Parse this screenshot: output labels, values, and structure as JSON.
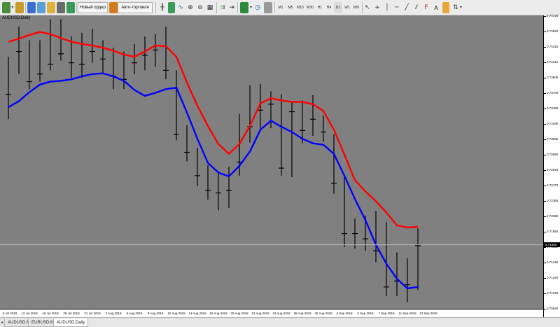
{
  "toolbar": {
    "new_order_label": "Новый ордер",
    "autotrading_label": "Авто-торговля",
    "timeframes": [
      "M1",
      "M5",
      "M15",
      "M30",
      "H1",
      "H4",
      "D1",
      "W1",
      "MN"
    ],
    "text_tool_label": "A",
    "icons": [
      "new-chart-icon",
      "profiles-icon",
      "market-watch-icon",
      "data-window-icon",
      "navigator-icon",
      "terminal-icon",
      "strategy-tester-icon",
      "new-order-icon",
      "autotrading-icon",
      "bar-chart-icon",
      "candlesticks-icon",
      "line-chart-icon",
      "zoom-in-icon",
      "zoom-out-icon",
      "tile-windows-icon",
      "autoscroll-icon",
      "chart-shift-icon",
      "indicators-icon",
      "periods-icon",
      "templates-icon",
      "cursor-icon",
      "crosshair-icon",
      "vertical-line-icon",
      "horizontal-line-icon",
      "trendline-icon",
      "channel-icon",
      "fibonacci-icon",
      "text-label-icon",
      "arrows-icon"
    ]
  },
  "chart": {
    "title": "AUDUSD,Daily",
    "current_price": "0.71680",
    "price_ticks": [
      "0.74725",
      "0.74520",
      "0.74315",
      "0.74110",
      "0.73905",
      "0.73700",
      "0.73495",
      "0.73290",
      "0.73085",
      "0.72880",
      "0.72675",
      "0.72470",
      "0.72265",
      "0.72060",
      "0.71855",
      "0.71650",
      "0.71445",
      "0.71240",
      "0.71035",
      "0.70830"
    ],
    "date_ticks": [
      "9 Jul 2018",
      "13 Jul 2018",
      "19 Jul 2018",
      "25 Jul 2018",
      "31 Jul 2018",
      "2 Aug 2018",
      "6 Aug 2018",
      "9 Aug 2018",
      "10 Aug 2018",
      "14 Aug 2018",
      "16 Aug 2018",
      "20 Aug 2018",
      "22 Aug 2018",
      "24 Aug 2018",
      "28 Aug 2018",
      "30 Aug 2018",
      "3 Sep 2018",
      "5 Sep 2018",
      "7 Sep 2018",
      "11 Sep 2018",
      "13 Sep 2018"
    ],
    "colors": {
      "background": "#808080",
      "bars": "#000000",
      "upper_band": "#ff0000",
      "lower_band": "#0000ff",
      "bid_line": "#c0c0c0"
    }
  },
  "chart_data": {
    "type": "line",
    "title": "AUDUSD,Daily",
    "price_range": [
      0.7083,
      0.7473
    ],
    "bars": [
      {
        "high": 0.7418,
        "low": 0.7335,
        "open": 0.7368,
        "close": 0.7368
      },
      {
        "high": 0.7458,
        "low": 0.7395,
        "open": 0.7425,
        "close": 0.7425
      },
      {
        "high": 0.744,
        "low": 0.7375,
        "open": 0.7385,
        "close": 0.7385
      },
      {
        "high": 0.744,
        "low": 0.7385,
        "open": 0.7395,
        "close": 0.7395
      },
      {
        "high": 0.7468,
        "low": 0.74,
        "open": 0.7408,
        "close": 0.7408
      },
      {
        "high": 0.7468,
        "low": 0.7413,
        "open": 0.7422,
        "close": 0.7422
      },
      {
        "high": 0.7445,
        "low": 0.739,
        "open": 0.741,
        "close": 0.741
      },
      {
        "high": 0.745,
        "low": 0.739,
        "open": 0.7408,
        "close": 0.7408
      },
      {
        "high": 0.7455,
        "low": 0.741,
        "open": 0.7425,
        "close": 0.7425
      },
      {
        "high": 0.744,
        "low": 0.7395,
        "open": 0.7415,
        "close": 0.7415
      },
      {
        "high": 0.743,
        "low": 0.7375,
        "open": 0.7392,
        "close": 0.7392
      },
      {
        "high": 0.7425,
        "low": 0.7375,
        "open": 0.7388,
        "close": 0.7388
      },
      {
        "high": 0.7435,
        "low": 0.7395,
        "open": 0.741,
        "close": 0.741
      },
      {
        "high": 0.7445,
        "low": 0.74,
        "open": 0.742,
        "close": 0.742
      },
      {
        "high": 0.7448,
        "low": 0.7405,
        "open": 0.7427,
        "close": 0.7427
      },
      {
        "high": 0.7458,
        "low": 0.7388,
        "open": 0.74,
        "close": 0.74
      },
      {
        "high": 0.74,
        "low": 0.7307,
        "open": 0.7315,
        "close": 0.7315
      },
      {
        "high": 0.7327,
        "low": 0.7279,
        "open": 0.7291,
        "close": 0.7291
      },
      {
        "high": 0.7297,
        "low": 0.7246,
        "open": 0.726,
        "close": 0.726
      },
      {
        "high": 0.7274,
        "low": 0.7228,
        "open": 0.724,
        "close": 0.724
      },
      {
        "high": 0.7266,
        "low": 0.7214,
        "open": 0.7237,
        "close": 0.7237
      },
      {
        "high": 0.7272,
        "low": 0.7217,
        "open": 0.724,
        "close": 0.724
      },
      {
        "high": 0.7342,
        "low": 0.726,
        "open": 0.7278,
        "close": 0.7278
      },
      {
        "high": 0.738,
        "low": 0.7304,
        "open": 0.7325,
        "close": 0.7325
      },
      {
        "high": 0.7382,
        "low": 0.732,
        "open": 0.7347,
        "close": 0.7347
      },
      {
        "high": 0.7372,
        "low": 0.7323,
        "open": 0.7355,
        "close": 0.7355
      },
      {
        "high": 0.7368,
        "low": 0.726,
        "open": 0.727,
        "close": 0.727
      },
      {
        "high": 0.7358,
        "low": 0.7258,
        "open": 0.7345,
        "close": 0.7345
      },
      {
        "high": 0.736,
        "low": 0.7303,
        "open": 0.732,
        "close": 0.732
      },
      {
        "high": 0.7367,
        "low": 0.7313,
        "open": 0.7335,
        "close": 0.7335
      },
      {
        "high": 0.734,
        "low": 0.7305,
        "open": 0.7318,
        "close": 0.7318
      },
      {
        "high": 0.7315,
        "low": 0.7236,
        "open": 0.725,
        "close": 0.725
      },
      {
        "high": 0.726,
        "low": 0.7165,
        "open": 0.7183,
        "close": 0.7183
      },
      {
        "high": 0.7203,
        "low": 0.7163,
        "open": 0.7183,
        "close": 0.7183
      },
      {
        "high": 0.7207,
        "low": 0.716,
        "open": 0.7176,
        "close": 0.7176
      },
      {
        "high": 0.7213,
        "low": 0.7145,
        "open": 0.716,
        "close": 0.716
      },
      {
        "high": 0.7198,
        "low": 0.71,
        "open": 0.7112,
        "close": 0.7112
      },
      {
        "high": 0.7158,
        "low": 0.71,
        "open": 0.712,
        "close": 0.712
      },
      {
        "high": 0.715,
        "low": 0.7092,
        "open": 0.7115,
        "close": 0.7115
      },
      {
        "high": 0.719,
        "low": 0.7108,
        "open": 0.7167,
        "close": 0.7167
      }
    ],
    "series": [
      {
        "values": [
          0.7438,
          0.7442,
          0.7447,
          0.7451,
          0.7448,
          0.7443,
          0.7438,
          0.7435,
          0.7433,
          0.743,
          0.7426,
          0.7421,
          0.7418,
          0.7425,
          0.7433,
          0.7432,
          0.7418,
          0.7384,
          0.7353,
          0.7326,
          0.7302,
          0.7289,
          0.7302,
          0.7326,
          0.7356,
          0.7363,
          0.736,
          0.7358,
          0.7358,
          0.7355,
          0.7346,
          0.7321,
          0.7288,
          0.7254,
          0.7239,
          0.7226,
          0.7211,
          0.7194,
          0.7191,
          0.7192
        ]
      },
      {
        "values": [
          0.7351,
          0.7359,
          0.7371,
          0.7381,
          0.7385,
          0.7386,
          0.7388,
          0.7392,
          0.7395,
          0.7396,
          0.7392,
          0.7386,
          0.7374,
          0.7366,
          0.737,
          0.7375,
          0.7377,
          0.7344,
          0.7309,
          0.7277,
          0.7264,
          0.7259,
          0.7273,
          0.7292,
          0.7321,
          0.7333,
          0.7325,
          0.7318,
          0.7309,
          0.7303,
          0.7301,
          0.7289,
          0.726,
          0.7229,
          0.7201,
          0.7168,
          0.7143,
          0.7123,
          0.711,
          0.7112
        ]
      }
    ],
    "ylabel": "",
    "xlabel": ""
  },
  "tabs": [
    {
      "label": "AUDUSD,M5"
    },
    {
      "label": "EURUSD,M5"
    },
    {
      "label": "AUDUSD,Daily"
    }
  ]
}
